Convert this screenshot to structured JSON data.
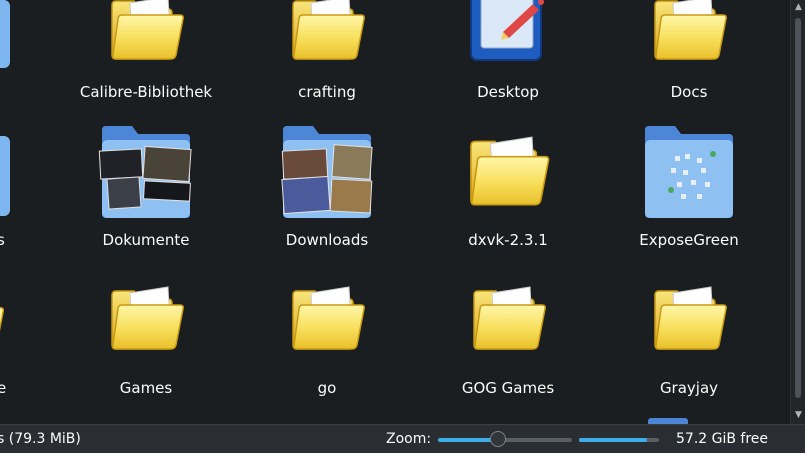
{
  "view": {
    "items": [
      {
        "label": "Calibre-Bibliothek",
        "icon": "folder-icon"
      },
      {
        "label": "crafting",
        "icon": "folder-icon"
      },
      {
        "label": "Desktop",
        "icon": "desktop-folder-icon"
      },
      {
        "label": "Docs",
        "icon": "folder-icon"
      },
      {
        "label": "Dokumente",
        "icon": "folder-preview-icon"
      },
      {
        "label": "Downloads",
        "icon": "folder-preview-icon"
      },
      {
        "label": "dxvk-2.3.1",
        "icon": "folder-icon"
      },
      {
        "label": "ExposeGreen",
        "icon": "folder-preview-icon"
      },
      {
        "label": "Games",
        "icon": "folder-icon"
      },
      {
        "label": "go",
        "icon": "folder-icon"
      },
      {
        "label": "GOG Games",
        "icon": "folder-icon"
      },
      {
        "label": "Grayjay",
        "icon": "folder-icon"
      }
    ],
    "left_partial": [
      "s",
      "e"
    ]
  },
  "status": {
    "selection": "s (79.3 MiB)",
    "zoom_label": "Zoom:",
    "zoom_level": 0.45,
    "space_used_fraction": 0.85,
    "free_space": "57.2 GiB free"
  },
  "colors": {
    "accent": "#3daee9",
    "folder": "#f5d94a",
    "background": "#1b1e20"
  }
}
